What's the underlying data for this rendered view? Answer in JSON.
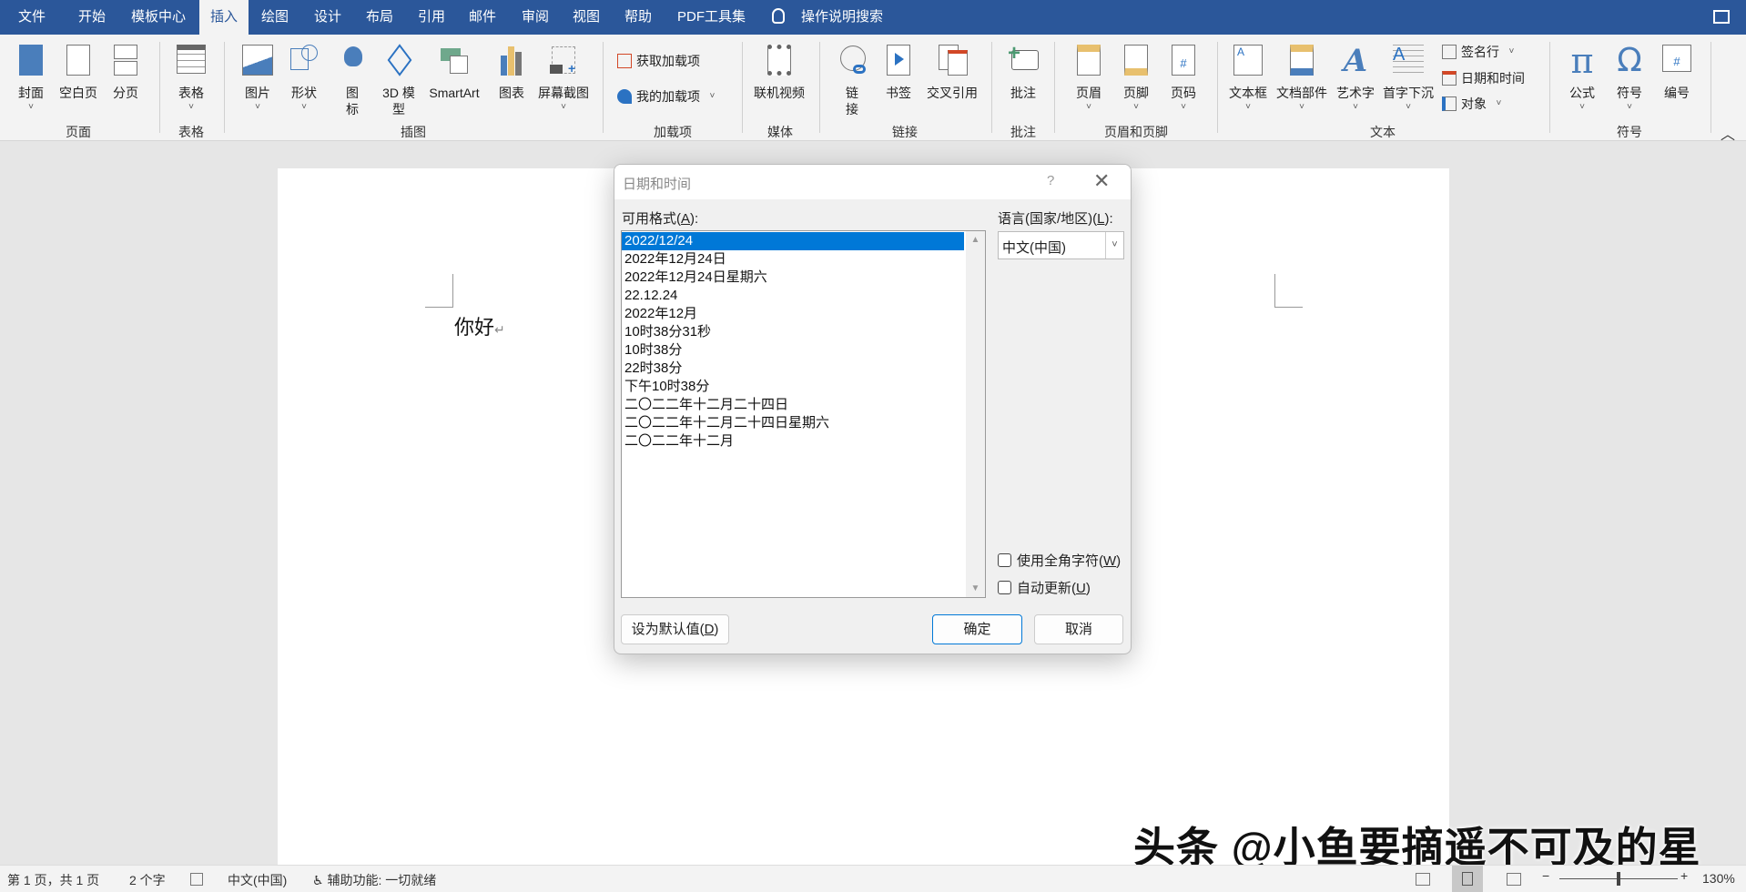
{
  "tabs": [
    "文件",
    "开始",
    "模板中心",
    "插入",
    "绘图",
    "设计",
    "布局",
    "引用",
    "邮件",
    "审阅",
    "视图",
    "帮助",
    "PDF工具集"
  ],
  "active_tab": "插入",
  "tell_me": "操作说明搜索",
  "ribbon": {
    "groups": [
      "页面",
      "表格",
      "插图",
      "加载项",
      "媒体",
      "链接",
      "批注",
      "页眉和页脚",
      "文本",
      "符号"
    ],
    "buttons": [
      "封面",
      "空白页",
      "分页",
      "表格",
      "图片",
      "形状",
      "图\n标",
      "3D 模\n型",
      "SmartArt",
      "图表",
      "屏幕截图",
      "联机视频",
      "链\n接",
      "书签",
      "交叉引用",
      "批注",
      "页眉",
      "页脚",
      "页码",
      "文本框",
      "文档部件",
      "艺术字",
      "首字下沉",
      "公式",
      "符号",
      "编号"
    ],
    "small": {
      "get_addins": "获取加载项",
      "my_addins": "我的加载项",
      "signature": "签名行",
      "datetime": "日期和时间",
      "object": "对象"
    }
  },
  "document": {
    "text": "你好"
  },
  "dialog": {
    "title": "日期和时间",
    "help": "?",
    "formats_label": "可用格式(",
    "formats_key": "A",
    "formats_tail": "):",
    "formats": [
      "2022/12/24",
      "2022年12月24日",
      "2022年12月24日星期六",
      "22.12.24",
      "2022年12月",
      "10时38分31秒",
      "10时38分",
      "22时38分",
      "下午10时38分",
      "二〇二二年十二月二十四日",
      "二〇二二年十二月二十四日星期六",
      "二〇二二年十二月"
    ],
    "selected_index": 0,
    "language_label": "语言(国家/地区)(",
    "language_key": "L",
    "language_tail": "):",
    "language_value": "中文(中国)",
    "fullwidth_label": "使用全角字符(",
    "fullwidth_key": "W",
    "fullwidth_checked": false,
    "autoupdate_label": "自动更新(",
    "autoupdate_key": "U",
    "autoupdate_checked": false,
    "default_label": "设为默认值(",
    "default_key": "D",
    "close_paren": ")",
    "ok": "确定",
    "cancel": "取消"
  },
  "status": {
    "page": "第 1 页，共 1 页",
    "words": "2 个字",
    "language": "中文(中国)",
    "accessibility": "辅助功能: 一切就绪",
    "zoom": "130%",
    "zoom_level_percent": 130
  },
  "watermark": "头条 @小鱼要摘遥不可及的星",
  "colors": {
    "titlebar": "#2b579a",
    "accent": "#0078d7"
  }
}
